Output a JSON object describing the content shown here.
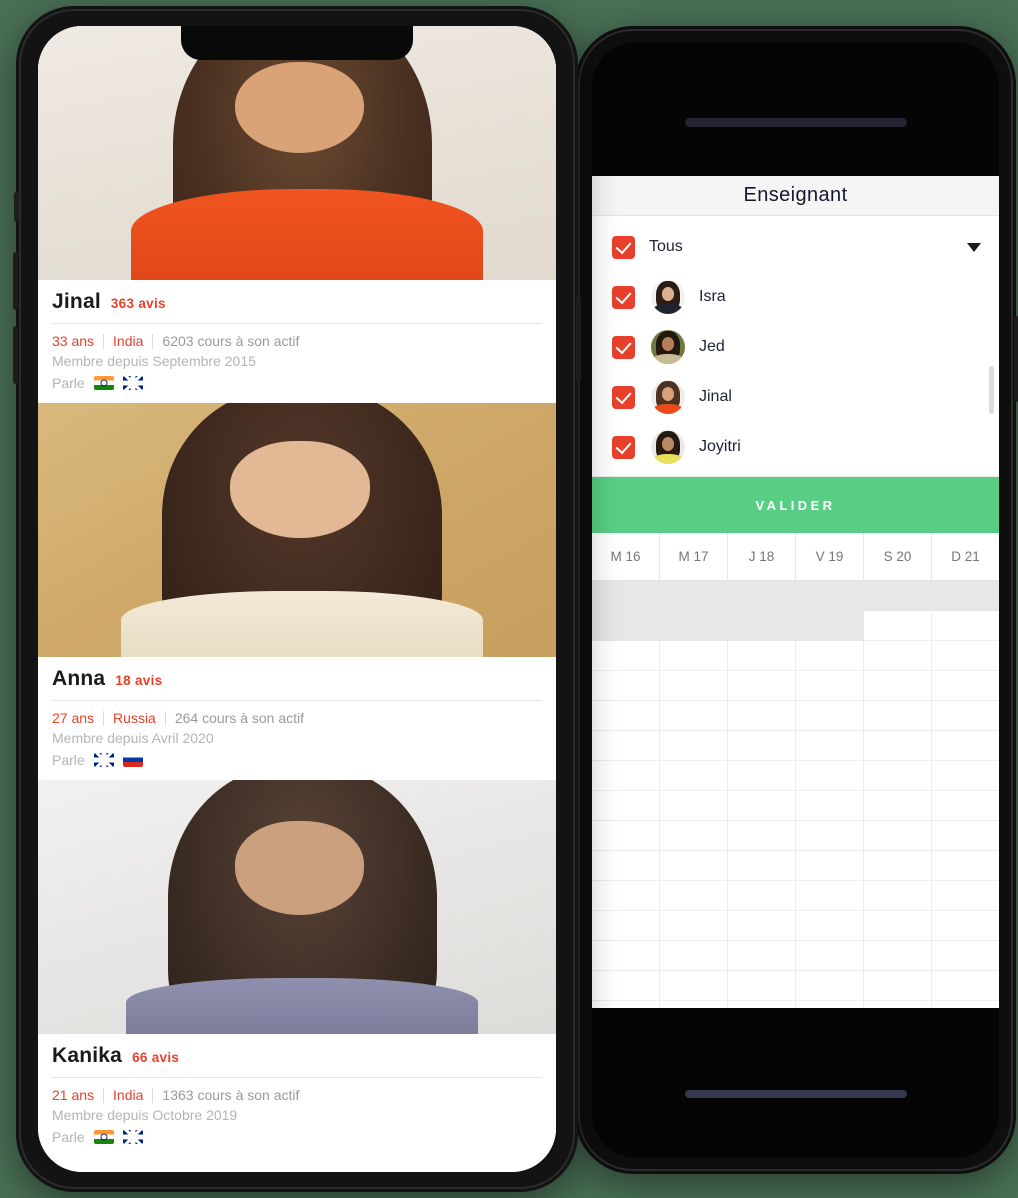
{
  "colors": {
    "accent_red": "#E8402A",
    "accent_green": "#58CE85",
    "background": "#4A7056",
    "blocked_cell": "#E7E7E7",
    "muted_text": "#9A9A9A"
  },
  "left_phone": {
    "teacher_cards": [
      {
        "name": "Jinal",
        "reviews": "363 avis",
        "age": "33 ans",
        "country": "India",
        "courses": "6203 cours à son actif",
        "member_since": "Membre depuis Septembre 2015",
        "speaks_label": "Parle",
        "flags": [
          "india-flag",
          "uk-flag"
        ],
        "photo": "jinal-photo"
      },
      {
        "name": "Anna",
        "reviews": "18 avis",
        "age": "27 ans",
        "country": "Russia",
        "courses": "264 cours à son actif",
        "member_since": "Membre depuis Avril 2020",
        "speaks_label": "Parle",
        "flags": [
          "uk-flag",
          "russia-flag"
        ],
        "photo": "anna-photo"
      },
      {
        "name": "Kanika",
        "reviews": "66 avis",
        "age": "21 ans",
        "country": "India",
        "courses": "1363 cours à son actif",
        "member_since": "Membre depuis Octobre 2019",
        "speaks_label": "Parle",
        "flags": [
          "india-flag",
          "uk-flag"
        ],
        "photo": "kanika-photo"
      }
    ]
  },
  "right_phone": {
    "header": {
      "title": "Enseignant"
    },
    "select_all": {
      "label": "Tous",
      "checked": true
    },
    "teachers": [
      {
        "label": "Isra",
        "checked": true,
        "avatar": "isra-avatar"
      },
      {
        "label": "Jed",
        "checked": true,
        "avatar": "jed-avatar"
      },
      {
        "label": "Jinal",
        "checked": true,
        "avatar": "jinal-avatar"
      },
      {
        "label": "Joyitri",
        "checked": true,
        "avatar": "joyitri-avatar"
      }
    ],
    "validate_button": {
      "label": "VALIDER"
    },
    "calendar": {
      "day_headers": [
        "M 16",
        "M 17",
        "J 18",
        "V 19",
        "S 20",
        "D 21"
      ],
      "rows": [
        {
          "cells": [
            "blocked",
            "blocked",
            "blocked",
            "blocked",
            "blocked",
            "blocked"
          ]
        },
        {
          "cells": [
            "blocked",
            "blocked",
            "blocked",
            "blocked",
            "free",
            "free"
          ]
        },
        {
          "cells": [
            "free",
            "free",
            "free",
            "free",
            "free",
            "free"
          ]
        },
        {
          "cells": [
            "free",
            "free",
            "free",
            "free",
            "free",
            "free"
          ]
        },
        {
          "cells": [
            "free",
            "free",
            "free",
            "free",
            "free",
            "free"
          ]
        },
        {
          "cells": [
            "free",
            "free",
            "free",
            "free",
            "free",
            "free"
          ]
        },
        {
          "cells": [
            "free",
            "free",
            "free",
            "free",
            "free",
            "free"
          ]
        },
        {
          "cells": [
            "free",
            "free",
            "free",
            "free",
            "free",
            "free"
          ]
        },
        {
          "cells": [
            "free",
            "free",
            "free",
            "free",
            "free",
            "free"
          ]
        },
        {
          "cells": [
            "free",
            "free",
            "free",
            "free",
            "free",
            "free"
          ]
        },
        {
          "cells": [
            "free",
            "free",
            "free",
            "free",
            "free",
            "free"
          ]
        },
        {
          "cells": [
            "free",
            "free",
            "free",
            "free",
            "free",
            "free"
          ]
        },
        {
          "cells": [
            "free",
            "free",
            "free",
            "free",
            "free",
            "free"
          ]
        },
        {
          "cells": [
            "free",
            "free",
            "free",
            "free",
            "free",
            "free"
          ]
        },
        {
          "cells": [
            "free",
            "free",
            "free",
            "free",
            "free",
            "free"
          ]
        }
      ]
    }
  }
}
